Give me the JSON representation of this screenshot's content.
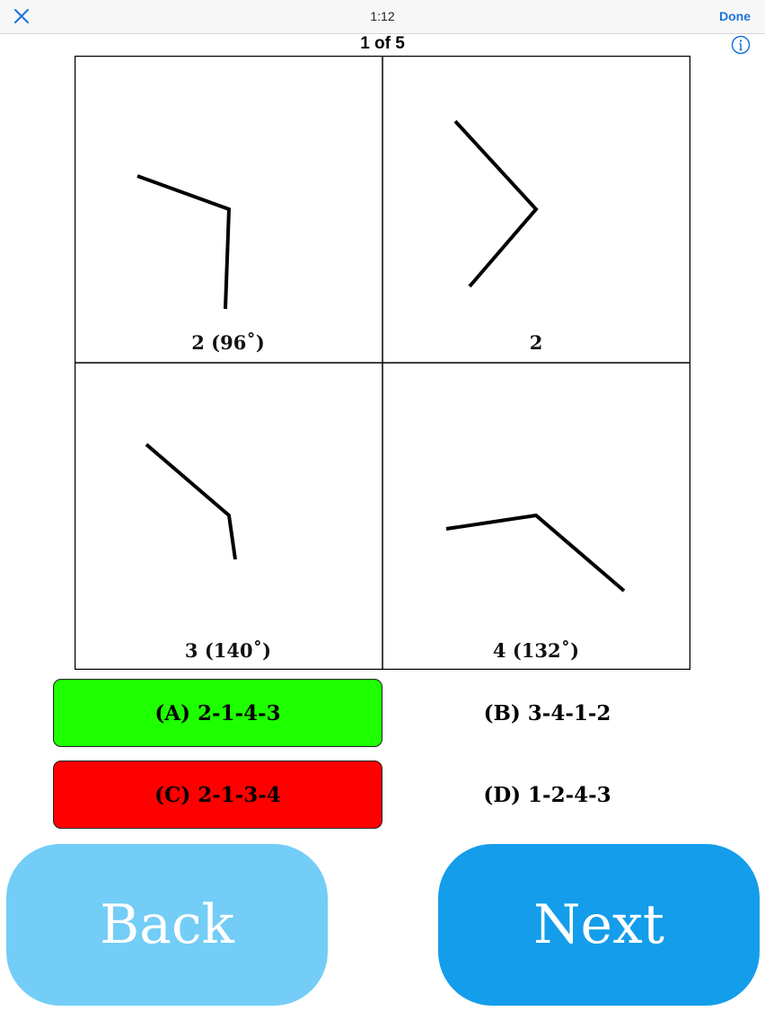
{
  "header": {
    "time": "1:12",
    "done_label": "Done"
  },
  "progress": "1 of 5",
  "cells": [
    {
      "label": "2 (96˚)"
    },
    {
      "label": "2"
    },
    {
      "label": "3 (140˚)"
    },
    {
      "label": "4 (132˚)"
    }
  ],
  "options": [
    {
      "label": "(A)  2-1-4-3",
      "state": "correct",
      "color": "#1eff00"
    },
    {
      "label": "(B)  3-4-1-2",
      "state": "none"
    },
    {
      "label": "(C)  2-1-3-4",
      "state": "wrong",
      "color": "#ff0000"
    },
    {
      "label": "(D)  1-2-4-3",
      "state": "none"
    }
  ],
  "nav": {
    "back_label": "Back",
    "back_color": "#73cdf6",
    "next_label": "Next",
    "next_color": "#149deb"
  },
  "colors": {
    "accent": "#1a73d9"
  }
}
